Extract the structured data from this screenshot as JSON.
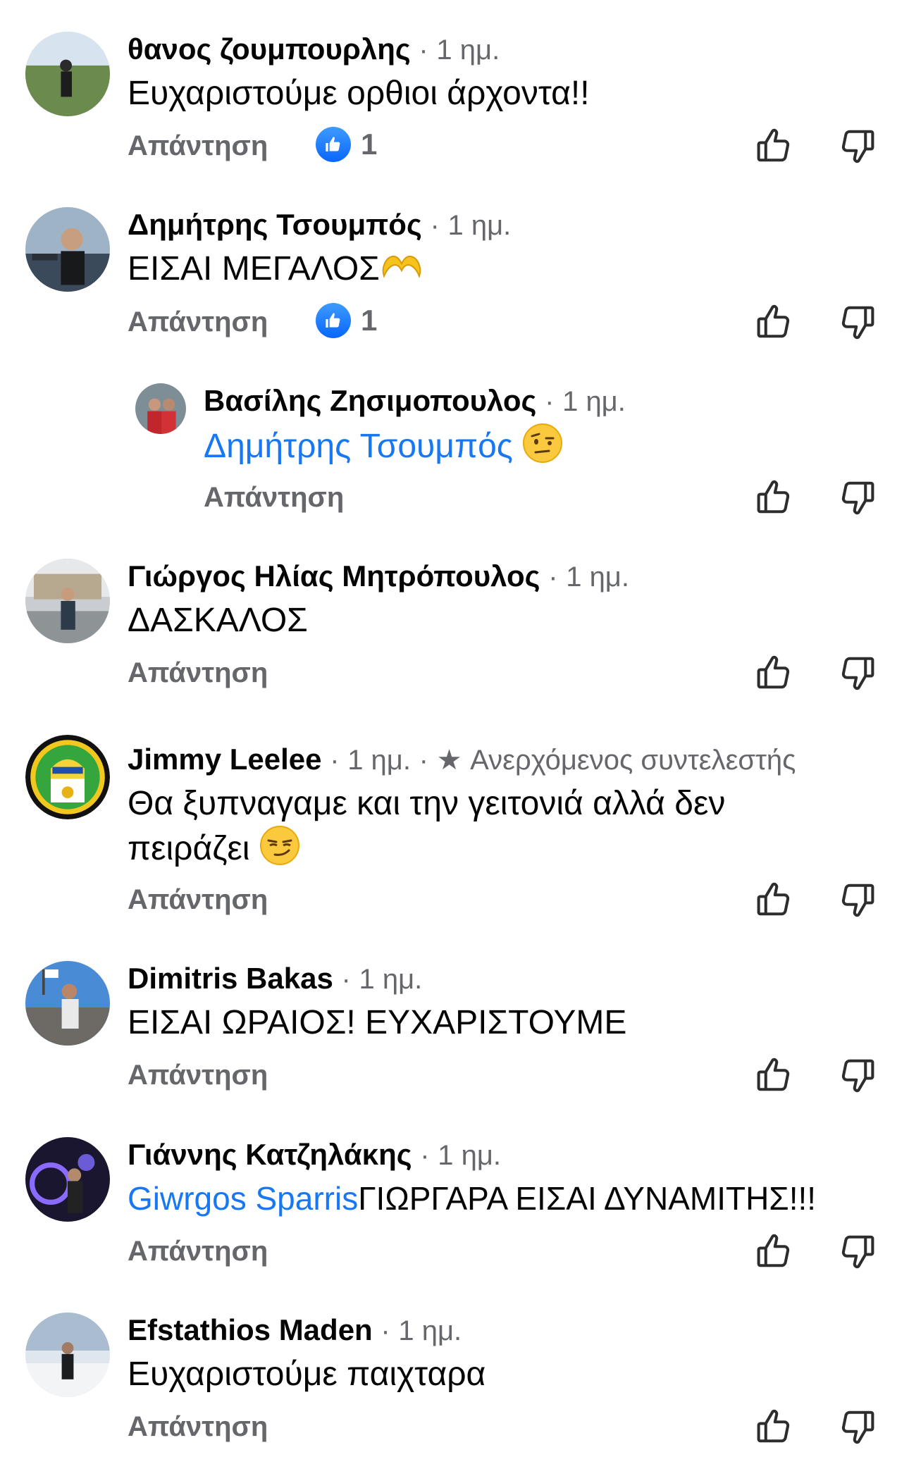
{
  "ui": {
    "reply_label": "Απάντηση",
    "separator": "·",
    "icons": {
      "like": "thumbs-up-icon",
      "dislike": "thumbs-down-icon",
      "reaction": "like-reaction-icon",
      "star": "star-icon"
    },
    "colors": {
      "name": "#050505",
      "meta": "#65676b",
      "mention": "#1877f2",
      "like_badge": "#0866ff"
    }
  },
  "comments": [
    {
      "author": "θανος ζουμπουρλης",
      "time": "1 ημ.",
      "text": "Ευχαριστούμε ορθιοι άρχοντα!!",
      "reaction_count": "1"
    },
    {
      "author": "Δημήτρης Τσουμπός",
      "time": "1 ημ.",
      "text": "ΕΙΣΑΙ ΜΕΓΑΛΟΣ",
      "emoji": "heart-hands-emoji",
      "reaction_count": "1"
    },
    {
      "author": "Βασίλης Ζησιμοπουλος",
      "time": "1 ημ.",
      "mention": "Δημήτρης Τσουμπός",
      "emoji": "raised-eyebrow-emoji",
      "is_reply": true
    },
    {
      "author": "Γιώργος Ηλίας Μητρόπουλος",
      "time": "1 ημ.",
      "text": "ΔΑΣΚΑΛΟΣ"
    },
    {
      "author": "Jimmy Leelee",
      "time": "1 ημ.",
      "badge": "Ανερχόμενος συντελεστής",
      "text_line1": "Θα ξυπναγαμε και την γειτονιά αλλά δεν",
      "text_line2": "πειράζει",
      "emoji": "smirking-face-emoji"
    },
    {
      "author": "Dimitris Bakas",
      "time": "1 ημ.",
      "text": "ΕΙΣΑΙ ΩΡΑΙΟΣ! ΕΥΧΑΡΙΣΤΟΥΜΕ"
    },
    {
      "author": "Γιάννης Κατζηλάκης",
      "time": "1 ημ.",
      "mention": "Giwrgos Sparris",
      "text": "ΓΙΩΡΓΑΡΑ ΕΙΣΑΙ ΔΥΝΑΜΙΤΗΣ!!!"
    },
    {
      "author": "Efstathios Maden",
      "time": "1 ημ.",
      "text": "Ευχαριστούμε παιχταρα"
    }
  ]
}
